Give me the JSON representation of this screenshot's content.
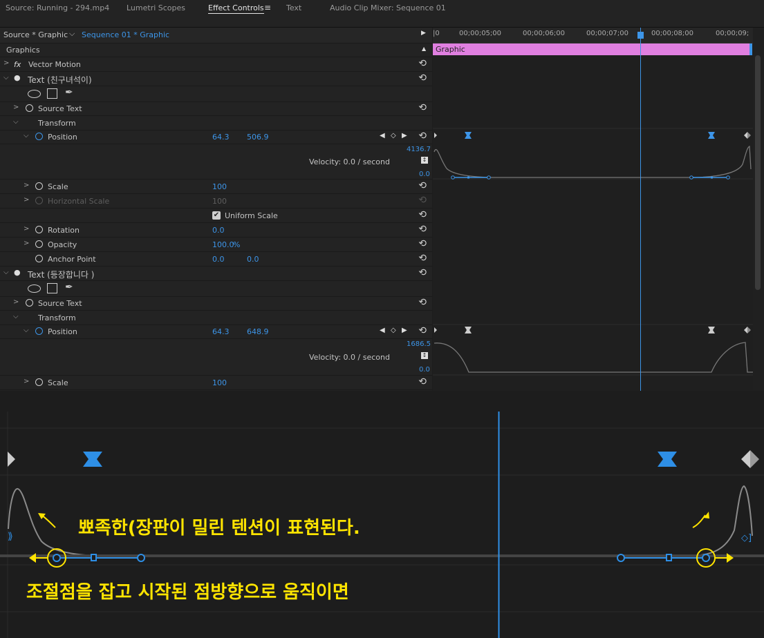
{
  "tabs": [
    "Source: Running - 294.mp4",
    "Lumetri Scopes",
    "Effect Controls",
    "Text",
    "Audio Clip Mixer: Sequence 01"
  ],
  "header": {
    "source": "Source * Graphic",
    "sequence": "Sequence 01 * Graphic"
  },
  "timeline": {
    "ticks": [
      "00;00;05;00",
      "00;00;06;00",
      "00;00;07;00",
      "00;00;08;00",
      "00;00;09;"
    ],
    "clip": "Graphic"
  },
  "section": "Graphics",
  "vector_motion": {
    "fx": "fx",
    "label": "Vector Motion"
  },
  "text1": {
    "label": "Text (친구녀석이)",
    "source_text": "Source Text",
    "transform": "Transform",
    "position": {
      "label": "Position",
      "x": "64.3",
      "y": "506.9"
    },
    "graph_max": "4136.7",
    "graph_min": "0.0",
    "velocity": "Velocity: 0.0 / second",
    "scale": {
      "label": "Scale",
      "value": "100"
    },
    "hscale": {
      "label": "Horizontal Scale",
      "value": "100"
    },
    "uniform": "Uniform Scale",
    "rotation": {
      "label": "Rotation",
      "value": "0.0"
    },
    "opacity": {
      "label": "Opacity",
      "value": "100.0",
      "unit": "%"
    },
    "anchor": {
      "label": "Anchor Point",
      "x": "0.0",
      "y": "0.0"
    }
  },
  "text2": {
    "label": "Text (등장합니다 )",
    "source_text": "Source Text",
    "transform": "Transform",
    "position": {
      "label": "Position",
      "x": "64.3",
      "y": "648.9"
    },
    "graph_max": "1686.5",
    "graph_min": "0.0",
    "velocity": "Velocity: 0.0 / second",
    "scale": {
      "label": "Scale",
      "value": "100"
    }
  },
  "annotations": {
    "line1": "뾰족한(장판이 밀린 텐션이 표현된다.",
    "line2": "조절점을 잡고 시작된 점방향으로 움직이면"
  },
  "colors": {
    "accent": "#3d95e8",
    "clip": "#e07fe0",
    "annotation": "#ffe400"
  }
}
